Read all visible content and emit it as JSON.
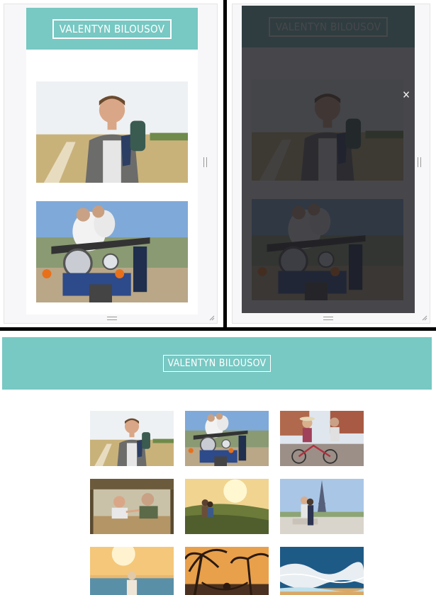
{
  "site": {
    "title": "VALENTYN BILOUSOV"
  },
  "lightbox": {
    "close_symbol": "✕"
  },
  "mobile_gallery": [
    {
      "id": "backpacker"
    },
    {
      "id": "motorcycle-couple"
    }
  ],
  "desktop_gallery": [
    {
      "id": "backpacker"
    },
    {
      "id": "motorcycle-couple"
    },
    {
      "id": "bicycle-couple"
    },
    {
      "id": "safari-jeep-couple"
    },
    {
      "id": "sunset-hill-couple"
    },
    {
      "id": "paris-eiffel-couple"
    },
    {
      "id": "beach-sunset-person"
    },
    {
      "id": "palm-hammock"
    },
    {
      "id": "ocean-waves"
    }
  ]
}
